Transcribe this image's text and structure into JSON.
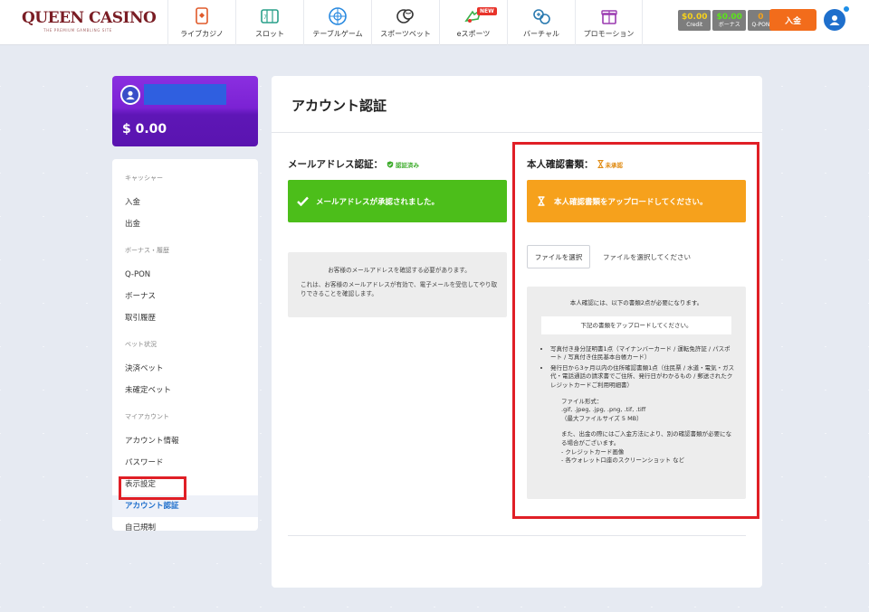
{
  "brand": {
    "logo_text": "QUEEN CASINO",
    "logo_tagline": "THE PREMIUM GAMBLING SITE"
  },
  "nav": [
    {
      "label": "ライブカジノ",
      "icon": "live-casino-icon"
    },
    {
      "label": "スロット",
      "icon": "slot-icon"
    },
    {
      "label": "テーブルゲーム",
      "icon": "roulette-icon"
    },
    {
      "label": "スポーツベット",
      "icon": "sports-ball-icon"
    },
    {
      "label": "eスポーツ",
      "icon": "esports-icon",
      "badge": "NEW"
    },
    {
      "label": "バーチャル",
      "icon": "virtual-icon"
    },
    {
      "label": "プロモーション",
      "icon": "gift-icon"
    }
  ],
  "balances": [
    {
      "value": "$0.00",
      "label": "Credit",
      "color": "#f6d21c"
    },
    {
      "value": "$0.00",
      "label": "ボーナス",
      "color": "#5ce21c"
    },
    {
      "value": "0",
      "label": "Q-PON",
      "color": "#f3a21c"
    }
  ],
  "header": {
    "deposit_label": "入金"
  },
  "user": {
    "balance": "$ 0.00"
  },
  "sidebar": {
    "groups": [
      {
        "heading": "キャッシャー",
        "items": [
          "入金",
          "出金"
        ]
      },
      {
        "heading": "ボーナス・履歴",
        "items": [
          "Q-PON",
          "ボーナス",
          "取引履歴"
        ]
      },
      {
        "heading": "ベット状況",
        "items": [
          "決済ベット",
          "未確定ベット"
        ]
      },
      {
        "heading": "マイアカウント",
        "items": [
          "アカウント情報",
          "パスワード",
          "表示設定",
          "アカウント認証",
          "自己規制"
        ]
      }
    ],
    "active_item": "アカウント認証"
  },
  "main": {
    "title": "アカウント認証",
    "email": {
      "heading": "メールアドレス認証：",
      "status": "認証済み",
      "alert": "メールアドレスが承認されました。",
      "info_line1": "お客様のメールアドレスを確認する必要があります。",
      "info_line2": "これは、お客様のメールアドレスが有効で、電子メールを受信してやり取りできることを確認します。"
    },
    "id_docs": {
      "heading": "本人確認書類：",
      "status": "未承認",
      "alert": "本人確認書類をアップロードしてください。",
      "file_button": "ファイルを選択",
      "file_status": "ファイルを選択してください",
      "req_title": "本人確認には、以下の書類2点が必要になります。",
      "req_sub": "下記の書類をアップロードしてください。",
      "req_item1": "写真付き身分証明書1点（マイナンバーカード / 運転免許証 / パスポート / 写真付き住民基本台帳カード）",
      "req_item2": "発行日から3ヶ月以内の住所確認書類1点（住民票 / 水道・電気・ガス代・電話通話の請求書でご住所、発行日がわかるもの / 郵送されたクレジットカードご利用明細書）",
      "format_label": "ファイル形式：",
      "formats": ".gif, .jpeg, .jpg, .png, .tif, .tiff",
      "max_size": "（最大ファイルサイズ 5 MB）",
      "note": "また、出金の際にはご入金方法により、別の確認書類が必要になる場合がございます。",
      "note_item1": "- クレジットカード画像",
      "note_item2": "- 各ウォレット口座のスクリーンショット など"
    }
  }
}
